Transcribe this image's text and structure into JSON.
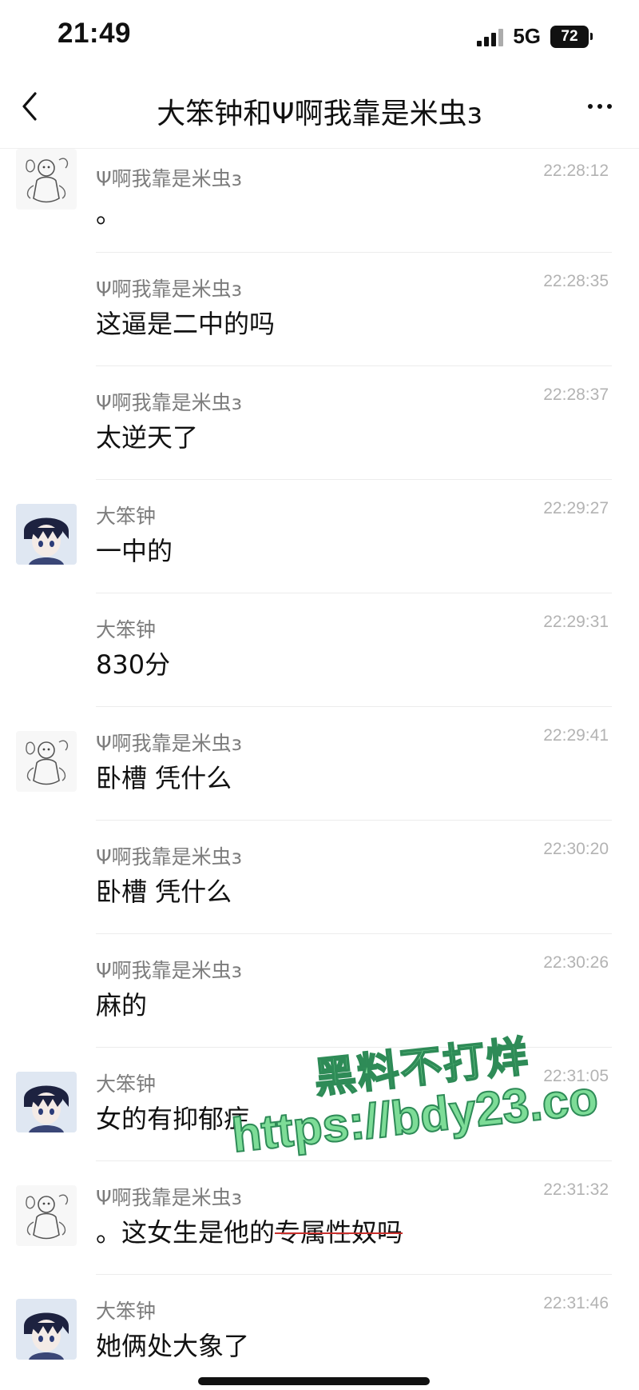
{
  "status_bar": {
    "time": "21:49",
    "network": "5G",
    "battery": "72"
  },
  "nav": {
    "title": "大笨钟和Ψ啊我靠是米虫з"
  },
  "messages": [
    {
      "sender": "Ψ啊我靠是米虫з",
      "time": "22:28:12",
      "text": "。",
      "avatar": "sketch"
    },
    {
      "sender": "Ψ啊我靠是米虫з",
      "time": "22:28:35",
      "text": "这逼是二中的吗",
      "avatar": null
    },
    {
      "sender": "Ψ啊我靠是米虫з",
      "time": "22:28:37",
      "text": "太逆天了",
      "avatar": null
    },
    {
      "sender": "大笨钟",
      "time": "22:29:27",
      "text": "一中的",
      "avatar": "anime"
    },
    {
      "sender": "大笨钟",
      "time": "22:29:31",
      "text": "830分",
      "avatar": null
    },
    {
      "sender": "Ψ啊我靠是米虫з",
      "time": "22:29:41",
      "text": "卧槽 凭什么",
      "avatar": "sketch"
    },
    {
      "sender": "Ψ啊我靠是米虫з",
      "time": "22:30:20",
      "text": "卧槽 凭什么",
      "avatar": null
    },
    {
      "sender": "Ψ啊我靠是米虫з",
      "time": "22:30:26",
      "text": "麻的",
      "avatar": null
    },
    {
      "sender": "大笨钟",
      "time": "22:31:05",
      "text": "女的有抑郁症",
      "avatar": "anime"
    },
    {
      "sender": "Ψ啊我靠是米虫з",
      "time": "22:31:32",
      "text_plain": "。这女生是他的",
      "text_struck": "专属性奴吗",
      "avatar": "sketch"
    },
    {
      "sender": "大笨钟",
      "time": "22:31:46",
      "text": "她俩处大象了",
      "avatar": "anime"
    }
  ],
  "watermark": {
    "line1": "黑料不打烊",
    "line2": "https://bdy23.co"
  }
}
